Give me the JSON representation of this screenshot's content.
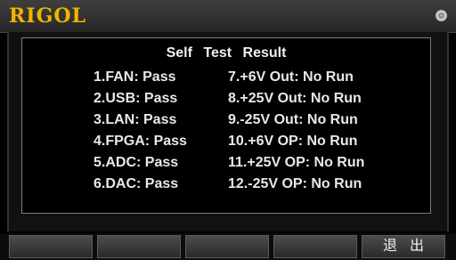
{
  "header": {
    "logo_text": "RIGOL",
    "status_icon": "disc-icon",
    "logo_color": "#f0b400"
  },
  "panel": {
    "title": "Self Test Result",
    "left_items": [
      "1.FAN: Pass",
      "2.USB: Pass",
      "3.LAN: Pass",
      "4.FPGA: Pass",
      "5.ADC: Pass",
      "6.DAC: Pass"
    ],
    "right_items": [
      "7.+6V Out: No Run",
      "8.+25V Out: No Run",
      "9.-25V Out: No Run",
      "10.+6V OP: No Run",
      "11.+25V OP: No Run",
      "12.-25V OP: No Run"
    ]
  },
  "softkeys": [
    "",
    "",
    "",
    "",
    "退出"
  ]
}
